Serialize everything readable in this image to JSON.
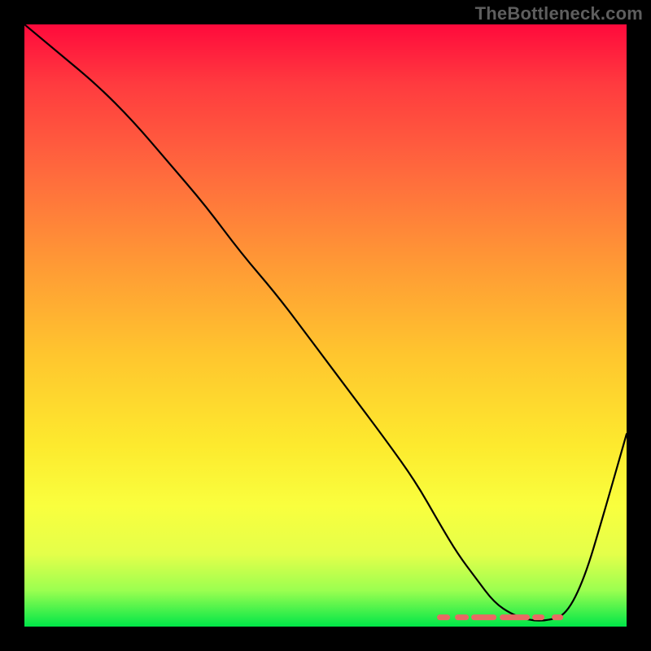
{
  "watermark": "TheBottleneck.com",
  "colors": {
    "page_background": "#000000",
    "curve_stroke": "#000000",
    "minimum_marker": "#e86a64",
    "gradient_top": "#ff0a3c",
    "gradient_bottom": "#00e648",
    "watermark_text": "#5e5e5e"
  },
  "chart_data": {
    "type": "line",
    "title": "",
    "xlabel": "",
    "ylabel": "",
    "xlim": [
      0,
      100
    ],
    "ylim": [
      0,
      100
    ],
    "grid": false,
    "legend": false,
    "background": "vertical-gradient",
    "description": "Bottleneck percentage curve over a performance/balance axis. Curve drops from ~100% at left to ~0% near the right, stays flat (optimal zone), then rises again toward the far right.",
    "series": [
      {
        "name": "bottleneck",
        "x": [
          0,
          6,
          12,
          18,
          24,
          30,
          36,
          42,
          48,
          54,
          60,
          65,
          69,
          72,
          75,
          78,
          81,
          84,
          87,
          90,
          93,
          96,
          100
        ],
        "y": [
          100,
          95,
          90,
          84,
          77,
          70,
          62,
          55,
          47,
          39,
          31,
          24,
          17,
          12,
          8,
          4,
          2,
          1,
          1,
          2,
          8,
          18,
          32
        ]
      }
    ],
    "optimal_zone": {
      "x_start": 69,
      "x_end": 89,
      "y": 1
    },
    "annotations": []
  }
}
